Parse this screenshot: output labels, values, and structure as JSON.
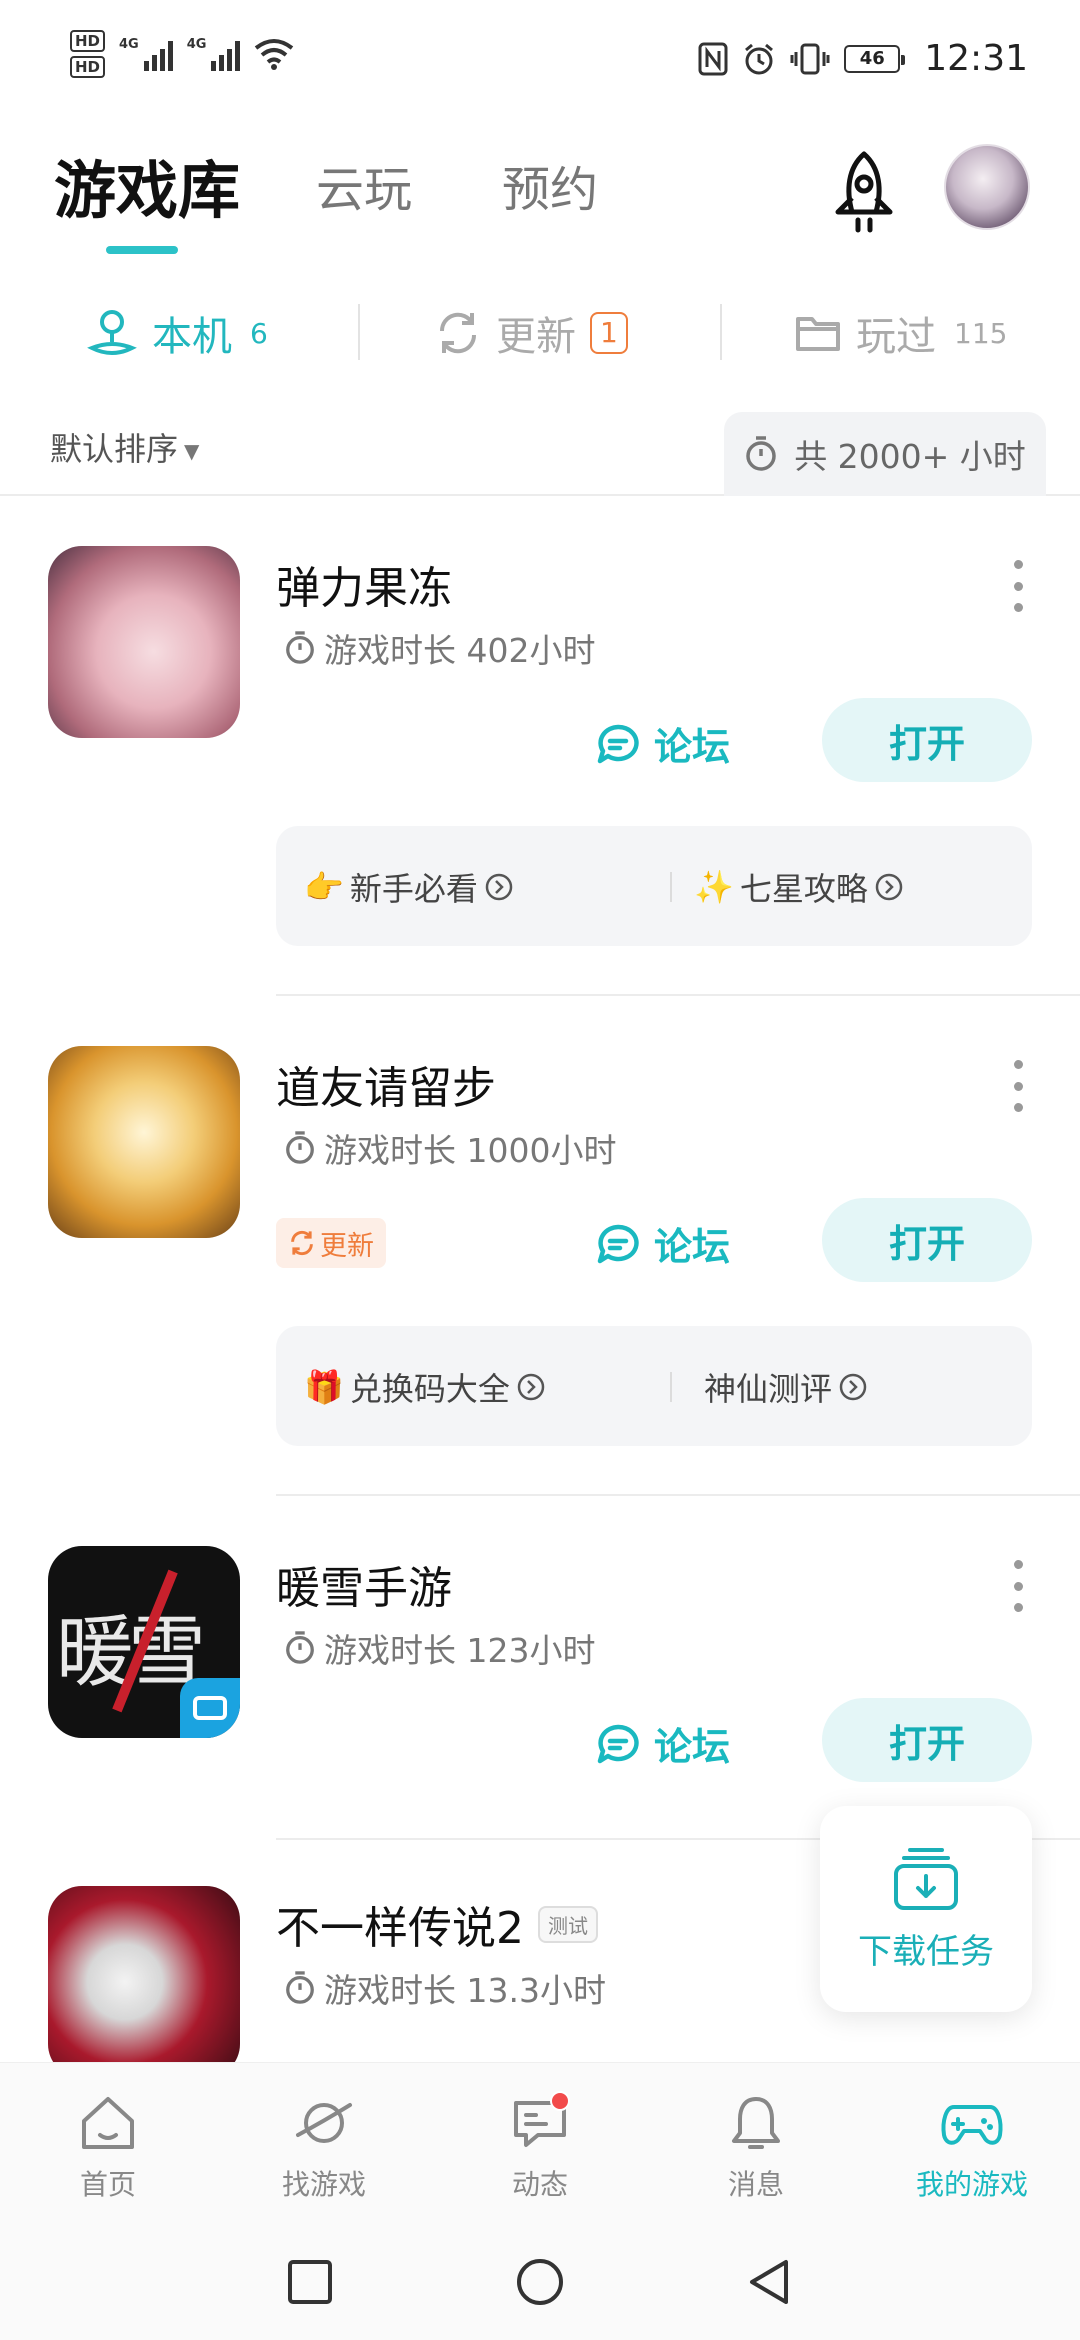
{
  "status_bar": {
    "hd1": "HD",
    "hd2": "HD",
    "net1": "4G",
    "net2": "4G",
    "battery": "46",
    "time": "12:31"
  },
  "top_tabs": {
    "library": "游戏库",
    "cloud": "云玩",
    "reserve": "预约"
  },
  "sub_tabs": {
    "local_label": "本机",
    "local_count": "6",
    "update_label": "更新",
    "update_count": "1",
    "played_label": "玩过",
    "played_count": "115"
  },
  "sort": {
    "label": "默认排序",
    "total_time": "共 2000+ 小时"
  },
  "games": [
    {
      "name": "弹力果冻",
      "play_time": "游戏时长 402小时",
      "forum": "论坛",
      "open": "打开",
      "link1": "新手必看",
      "link2": "七星攻略"
    },
    {
      "name": "道友请留步",
      "play_time": "游戏时长 1000小时",
      "update_tag": "更新",
      "forum": "论坛",
      "open": "打开",
      "link1": "兑换码大全",
      "link2": "神仙测评"
    },
    {
      "name": "暖雪手游",
      "play_time": "游戏时长 123小时",
      "forum": "论坛",
      "open": "打开"
    },
    {
      "name": "不一样传说2",
      "tag": "测试",
      "play_time": "游戏时长 13.3小时"
    }
  ],
  "download_task": "下载任务",
  "bottom_nav": {
    "home": "首页",
    "find": "找游戏",
    "feed": "动态",
    "messages": "消息",
    "my_games": "我的游戏"
  },
  "colors": {
    "accent": "#1ab9c0",
    "update": "#ef7d3c",
    "notification": "#f24b4b"
  }
}
